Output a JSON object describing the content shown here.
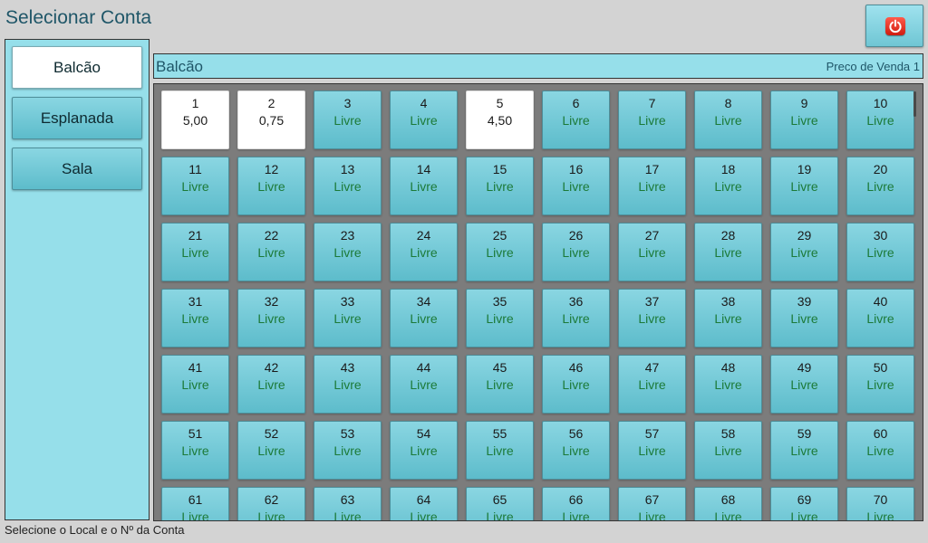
{
  "title": "Selecionar Conta",
  "power_button": {
    "icon": "power-icon",
    "icon_color": "#e3261a"
  },
  "colors": {
    "panel": "#96dfea",
    "tile": "#6fc6d4",
    "status_livre": "#1c7a38",
    "occupied": "#ffffff"
  },
  "locations": [
    {
      "label": "Balcão",
      "selected": true
    },
    {
      "label": "Esplanada",
      "selected": false
    },
    {
      "label": "Sala",
      "selected": false
    }
  ],
  "header": {
    "location": "Balcão",
    "price_label": "Preco de Venda 1"
  },
  "tables": [
    {
      "number": "1",
      "status": "5,00",
      "occupied": true
    },
    {
      "number": "2",
      "status": "0,75",
      "occupied": true
    },
    {
      "number": "3",
      "status": "Livre",
      "occupied": false
    },
    {
      "number": "4",
      "status": "Livre",
      "occupied": false
    },
    {
      "number": "5",
      "status": "4,50",
      "occupied": true
    },
    {
      "number": "6",
      "status": "Livre",
      "occupied": false
    },
    {
      "number": "7",
      "status": "Livre",
      "occupied": false
    },
    {
      "number": "8",
      "status": "Livre",
      "occupied": false
    },
    {
      "number": "9",
      "status": "Livre",
      "occupied": false
    },
    {
      "number": "10",
      "status": "Livre",
      "occupied": false
    },
    {
      "number": "11",
      "status": "Livre",
      "occupied": false
    },
    {
      "number": "12",
      "status": "Livre",
      "occupied": false
    },
    {
      "number": "13",
      "status": "Livre",
      "occupied": false
    },
    {
      "number": "14",
      "status": "Livre",
      "occupied": false
    },
    {
      "number": "15",
      "status": "Livre",
      "occupied": false
    },
    {
      "number": "16",
      "status": "Livre",
      "occupied": false
    },
    {
      "number": "17",
      "status": "Livre",
      "occupied": false
    },
    {
      "number": "18",
      "status": "Livre",
      "occupied": false
    },
    {
      "number": "19",
      "status": "Livre",
      "occupied": false
    },
    {
      "number": "20",
      "status": "Livre",
      "occupied": false
    },
    {
      "number": "21",
      "status": "Livre",
      "occupied": false
    },
    {
      "number": "22",
      "status": "Livre",
      "occupied": false
    },
    {
      "number": "23",
      "status": "Livre",
      "occupied": false
    },
    {
      "number": "24",
      "status": "Livre",
      "occupied": false
    },
    {
      "number": "25",
      "status": "Livre",
      "occupied": false
    },
    {
      "number": "26",
      "status": "Livre",
      "occupied": false
    },
    {
      "number": "27",
      "status": "Livre",
      "occupied": false
    },
    {
      "number": "28",
      "status": "Livre",
      "occupied": false
    },
    {
      "number": "29",
      "status": "Livre",
      "occupied": false
    },
    {
      "number": "30",
      "status": "Livre",
      "occupied": false
    },
    {
      "number": "31",
      "status": "Livre",
      "occupied": false
    },
    {
      "number": "32",
      "status": "Livre",
      "occupied": false
    },
    {
      "number": "33",
      "status": "Livre",
      "occupied": false
    },
    {
      "number": "34",
      "status": "Livre",
      "occupied": false
    },
    {
      "number": "35",
      "status": "Livre",
      "occupied": false
    },
    {
      "number": "36",
      "status": "Livre",
      "occupied": false
    },
    {
      "number": "37",
      "status": "Livre",
      "occupied": false
    },
    {
      "number": "38",
      "status": "Livre",
      "occupied": false
    },
    {
      "number": "39",
      "status": "Livre",
      "occupied": false
    },
    {
      "number": "40",
      "status": "Livre",
      "occupied": false
    },
    {
      "number": "41",
      "status": "Livre",
      "occupied": false
    },
    {
      "number": "42",
      "status": "Livre",
      "occupied": false
    },
    {
      "number": "43",
      "status": "Livre",
      "occupied": false
    },
    {
      "number": "44",
      "status": "Livre",
      "occupied": false
    },
    {
      "number": "45",
      "status": "Livre",
      "occupied": false
    },
    {
      "number": "46",
      "status": "Livre",
      "occupied": false
    },
    {
      "number": "47",
      "status": "Livre",
      "occupied": false
    },
    {
      "number": "48",
      "status": "Livre",
      "occupied": false
    },
    {
      "number": "49",
      "status": "Livre",
      "occupied": false
    },
    {
      "number": "50",
      "status": "Livre",
      "occupied": false
    },
    {
      "number": "51",
      "status": "Livre",
      "occupied": false
    },
    {
      "number": "52",
      "status": "Livre",
      "occupied": false
    },
    {
      "number": "53",
      "status": "Livre",
      "occupied": false
    },
    {
      "number": "54",
      "status": "Livre",
      "occupied": false
    },
    {
      "number": "55",
      "status": "Livre",
      "occupied": false
    },
    {
      "number": "56",
      "status": "Livre",
      "occupied": false
    },
    {
      "number": "57",
      "status": "Livre",
      "occupied": false
    },
    {
      "number": "58",
      "status": "Livre",
      "occupied": false
    },
    {
      "number": "59",
      "status": "Livre",
      "occupied": false
    },
    {
      "number": "60",
      "status": "Livre",
      "occupied": false
    },
    {
      "number": "61",
      "status": "Livre",
      "occupied": false
    },
    {
      "number": "62",
      "status": "Livre",
      "occupied": false
    },
    {
      "number": "63",
      "status": "Livre",
      "occupied": false
    },
    {
      "number": "64",
      "status": "Livre",
      "occupied": false
    },
    {
      "number": "65",
      "status": "Livre",
      "occupied": false
    },
    {
      "number": "66",
      "status": "Livre",
      "occupied": false
    },
    {
      "number": "67",
      "status": "Livre",
      "occupied": false
    },
    {
      "number": "68",
      "status": "Livre",
      "occupied": false
    },
    {
      "number": "69",
      "status": "Livre",
      "occupied": false
    },
    {
      "number": "70",
      "status": "Livre",
      "occupied": false
    }
  ],
  "status_text": "Selecione o Local e o Nº da Conta"
}
